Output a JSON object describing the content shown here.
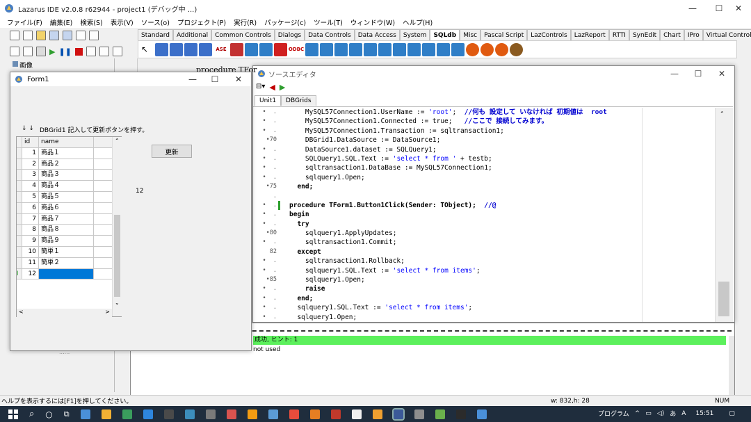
{
  "ide": {
    "title": "Lazarus IDE v2.0.8 r62944 - project1 (デバッグ中 ...)",
    "menu": [
      "ファイル(F)",
      "編集(E)",
      "検索(S)",
      "表示(V)",
      "ソース(o)",
      "プロジェクト(P)",
      "実行(R)",
      "パッケージ(c)",
      "ツール(T)",
      "ウィンドウ(W)",
      "ヘルプ(H)"
    ],
    "palette_tabs": [
      "Standard",
      "Additional",
      "Common Controls",
      "Dialogs",
      "Data Controls",
      "Data Access",
      "System",
      "SQLdb",
      "Misc",
      "Pascal Script",
      "LazControls",
      "LazReport",
      "RTTI",
      "SynEdit",
      "Chart",
      "IPro",
      "Virtual Controls"
    ],
    "active_tab": "SQLdb",
    "palette_labels": {
      "ase": "ASE",
      "odbc": "ODBC"
    },
    "objinsp_label": "画像",
    "palette_colors": [
      "#3b6fc9",
      "#3b6fc9",
      "#3b6fc9",
      "#3b6fc9",
      "#3b6fc9",
      "#c23030",
      "#2f7ec7",
      "#2f7ec7",
      "#d02020",
      "#d02020",
      "#2f7ec7",
      "#2f7ec7",
      "#2f7ec7",
      "#2f7ec7",
      "#2f7ec7",
      "#2f7ec7",
      "#2f7ec7",
      "#2f7ec7",
      "#2f7ec7",
      "#2f7ec7",
      "#2f7ec7",
      "#e05a10",
      "#e05a10",
      "#e05a10",
      "#8a5a20"
    ]
  },
  "form1": {
    "title": "Form1",
    "arrows": "↓ ↓",
    "label": "DBGrid1 記入して更新ボタンを押す。",
    "button_label": "更新",
    "count_label": "12",
    "grid_headers": [
      "id",
      "name"
    ],
    "rows": [
      {
        "id": "1",
        "name": "商品１"
      },
      {
        "id": "2",
        "name": "商品２"
      },
      {
        "id": "3",
        "name": "商品３"
      },
      {
        "id": "4",
        "name": "商品４"
      },
      {
        "id": "5",
        "name": "商品５"
      },
      {
        "id": "6",
        "name": "商品６"
      },
      {
        "id": "7",
        "name": "商品７"
      },
      {
        "id": "8",
        "name": "商品８"
      },
      {
        "id": "9",
        "name": "商品９"
      },
      {
        "id": "10",
        "name": "簡単１"
      },
      {
        "id": "11",
        "name": "簡単２"
      },
      {
        "id": "12",
        "name": ""
      }
    ]
  },
  "source_editor": {
    "title": "ソースエディタ",
    "tabs": [
      "Unit1",
      "DBGrids"
    ],
    "behind_text": "procedure TFor",
    "lines": [
      {
        "g": "•  .",
        "t": "    MySQL57Connection1.UserName := 'root';  //何も 設定して いなければ 初期値は  root"
      },
      {
        "g": "•  .",
        "t": "    MySQL57Connection1.Connected := true;   //ここで 接続してみます。"
      },
      {
        "g": "•  .",
        "t": "    MySQL57Connection1.Transaction := sqltransaction1;"
      },
      {
        "g": "•70",
        "t": "    DBGrid1.DataSource := DataSource1;"
      },
      {
        "g": "•  .",
        "t": "    DataSource1.dataset := SQLQuery1;"
      },
      {
        "g": "•  .",
        "t": "    SQLQuery1.SQL.Text := 'select * from ' + testb;"
      },
      {
        "g": "•  .",
        "t": "    sqltransaction1.DataBase := MySQL57Connection1;"
      },
      {
        "g": "•  .",
        "t": "    sqlquery1.Open;"
      },
      {
        "g": "•75",
        "t": "  end;"
      },
      {
        "g": ".",
        "t": ""
      },
      {
        "g": "•  .",
        "t": "procedure TForm1.Button1Click(Sender: TObject);  //@"
      },
      {
        "g": "•  .",
        "t": "begin"
      },
      {
        "g": "•  .",
        "t": "  try"
      },
      {
        "g": "•80",
        "t": "    sqlquery1.ApplyUpdates;"
      },
      {
        "g": "•  .",
        "t": "    sqltransaction1.Commit;"
      },
      {
        "g": "82",
        "t": "  except"
      },
      {
        "g": "•  .",
        "t": "    sqltransaction1.Rollback;"
      },
      {
        "g": "•  .",
        "t": "    sqlquery1.SQL.Text := 'select * from items';"
      },
      {
        "g": "•85",
        "t": "    sqlquery1.Open;"
      },
      {
        "g": "•  .",
        "t": "    raise"
      },
      {
        "g": "•  .",
        "t": "  end;"
      },
      {
        "g": "•  .",
        "t": "  sqlquery1.SQL.Text := 'select * from items';"
      },
      {
        "g": "•  .",
        "t": "  sqlquery1.Open;"
      }
    ]
  },
  "messages": {
    "success_text": "成功, ヒント: 1",
    "hint_text": "not used"
  },
  "status": {
    "help": "ヘルプを表示するには[F1]を押してください。",
    "size": "w: 832,h: 28",
    "num": "NUM"
  },
  "taskbar": {
    "tray_label": "プログラム",
    "ime": "A",
    "time": "15:51"
  }
}
